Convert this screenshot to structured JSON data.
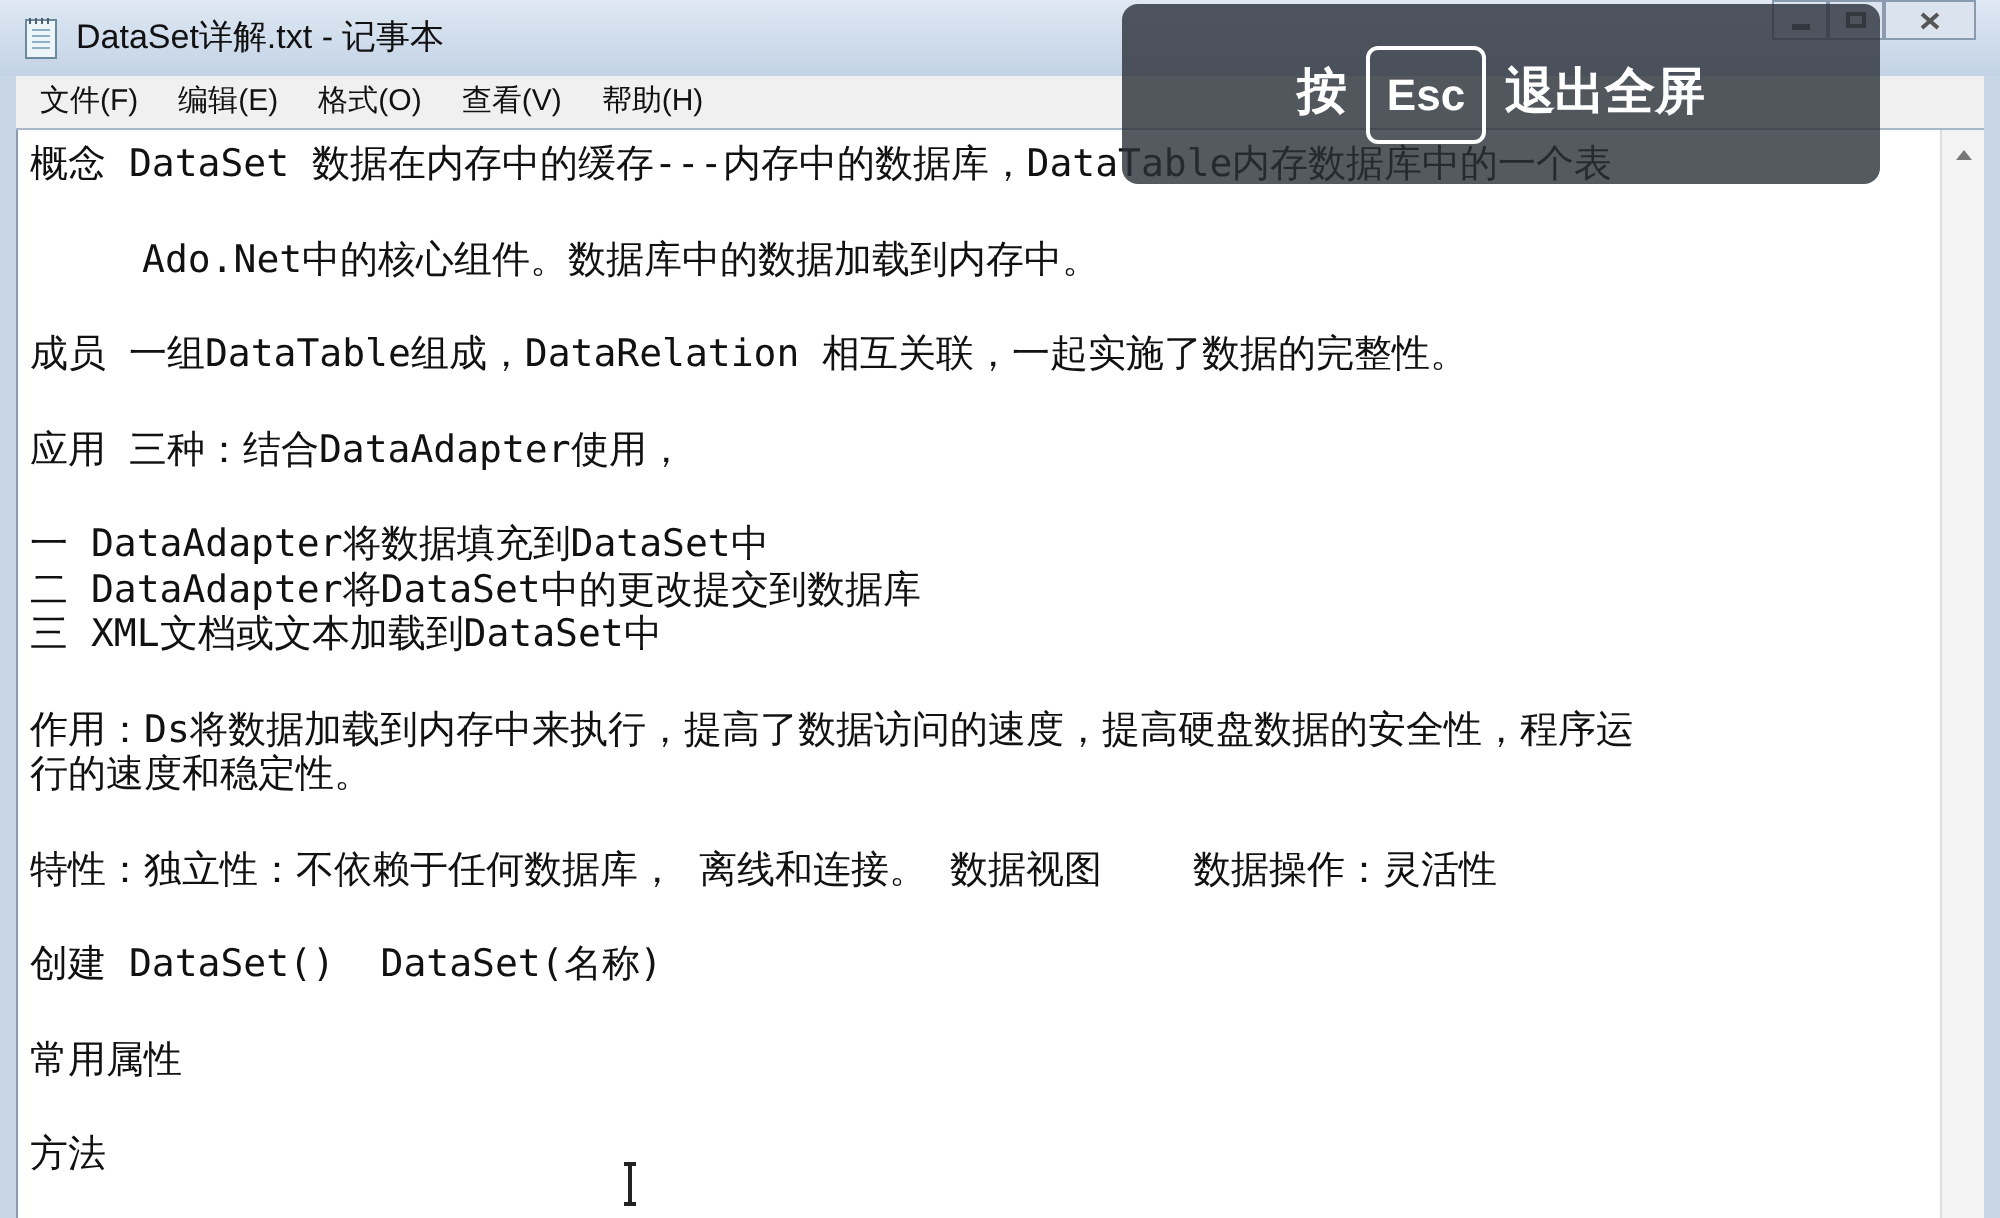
{
  "window": {
    "title": "DataSet详解.txt - 记事本"
  },
  "menu": [
    "文件(F)",
    "编辑(E)",
    "格式(O)",
    "查看(V)",
    "帮助(H)"
  ],
  "document": {
    "paragraphs": [
      {
        "indented": false,
        "lines": [
          "概念 DataSet 数据在内存中的缓存---内存中的数据库，DataTable内存数据库中的一个表"
        ]
      },
      {
        "indented": true,
        "lines": [
          "Ado.Net中的核心组件。数据库中的数据加载到内存中。"
        ]
      },
      {
        "indented": false,
        "lines": [
          "成员 一组DataTable组成，DataRelation 相互关联，一起实施了数据的完整性。"
        ]
      },
      {
        "indented": false,
        "lines": [
          "应用 三种：结合DataAdapter使用，"
        ]
      },
      {
        "indented": false,
        "lines": [
          "一 DataAdapter将数据填充到DataSet中",
          "二 DataAdapter将DataSet中的更改提交到数据库",
          "三 XML文档或文本加载到DataSet中"
        ]
      },
      {
        "indented": false,
        "lines": [
          "作用：Ds将数据加载到内存中来执行，提高了数据访问的速度，提高硬盘数据的安全性，程序运",
          "行的速度和稳定性。"
        ]
      },
      {
        "indented": false,
        "lines": [
          "特性：独立性：不依赖于任何数据库， 离线和连接。 数据视图    数据操作：灵活性"
        ]
      },
      {
        "indented": false,
        "lines": [
          "创建 DataSet()  DataSet(名称)"
        ]
      },
      {
        "indented": false,
        "lines": [
          "常用属性"
        ]
      },
      {
        "indented": false,
        "lines": [
          "方法"
        ]
      }
    ]
  },
  "fullscreen_hint": {
    "before": "按",
    "key": "Esc",
    "after": "退出全屏"
  }
}
